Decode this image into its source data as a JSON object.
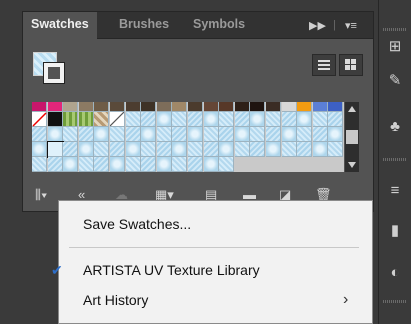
{
  "panel": {
    "tabs": [
      {
        "label": "Swatches",
        "active": true
      },
      {
        "label": "Brushes",
        "active": false
      },
      {
        "label": "Symbols",
        "active": false
      }
    ],
    "tab_icons": [
      "fast-forward-icon",
      "panel-menu-icon"
    ],
    "view_buttons": [
      "list-view-icon",
      "grid-view-icon"
    ],
    "bottom_icons": [
      "swatch-libraries-menu-icon",
      "add-to-library-icon",
      "cloud-icon",
      "show-swatch-kinds-icon",
      "swatch-options-icon",
      "new-color-group-icon",
      "new-swatch-icon",
      "delete-swatch-icon"
    ]
  },
  "context_menu": {
    "items": [
      {
        "label": "Save Swatches...",
        "checked": false,
        "submenu": false
      },
      {
        "label": "ARTISTA UV Texture Library",
        "checked": true,
        "submenu": false
      },
      {
        "label": "Art History",
        "checked": false,
        "submenu": true
      }
    ],
    "checkmark": "✔",
    "submenu_arrow": "›"
  },
  "colors": {
    "panel_bg": "#535353",
    "menu_bg": "#f2f2f2",
    "swatch_row_colors": [
      "#c8166b",
      "#e2267a",
      "#b0a48e",
      "#8c7a63",
      "#6e5c47",
      "#5a4a3a",
      "#4c3d30",
      "#3e3226",
      "#7d6d5a",
      "#a08868",
      "#4b3b2d",
      "#654636",
      "#573828",
      "#2e2018",
      "#1f1410",
      "#3a2c24",
      "#d8d8d8",
      "#f39c12",
      "#5b7fd6",
      "#3d60c4"
    ]
  }
}
